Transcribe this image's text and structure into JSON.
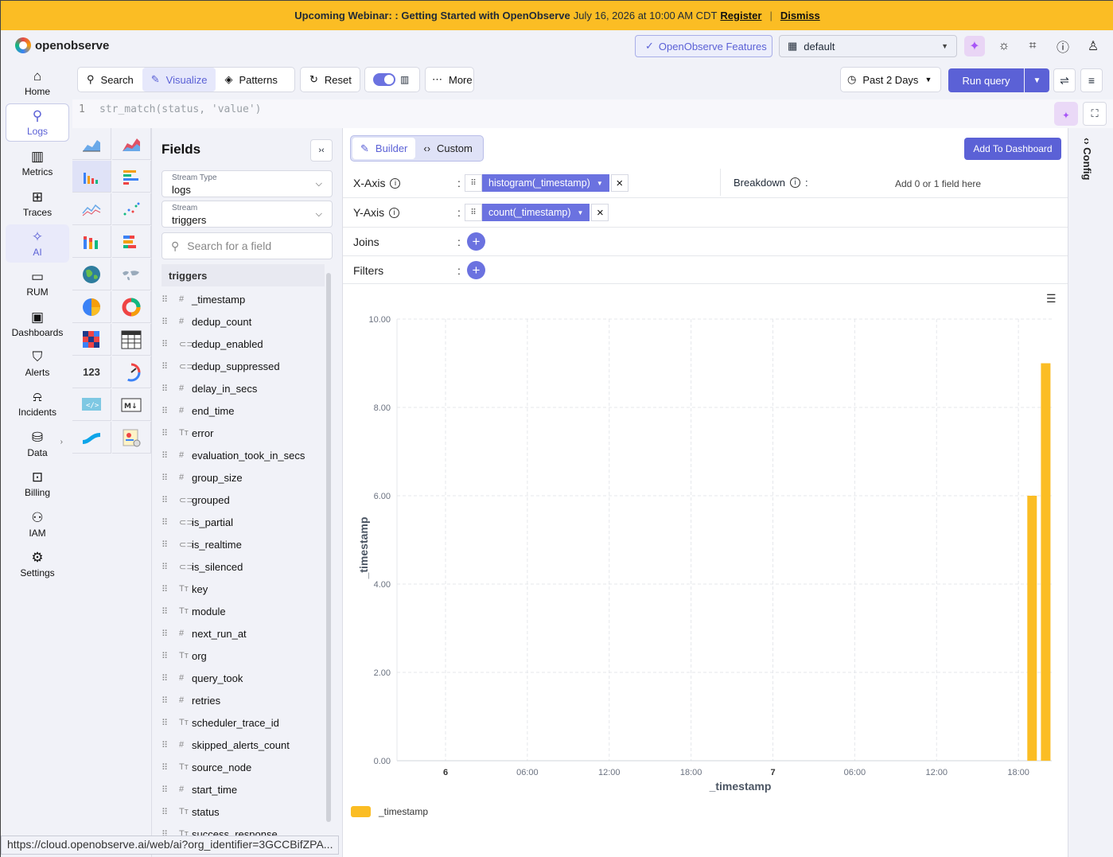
{
  "banner": {
    "title": "Upcoming Webinar: : Getting Started with OpenObserve",
    "date": "July 16, 2026 at 10:00 AM CDT",
    "register": "Register",
    "sep": "|",
    "dismiss": "Dismiss"
  },
  "header": {
    "logo": "openobserve",
    "features_label": "OpenObserve Features",
    "org": "default"
  },
  "sidebar": {
    "items": [
      {
        "label": "Home",
        "icon": "home-icon"
      },
      {
        "label": "Logs",
        "icon": "search-icon"
      },
      {
        "label": "Metrics",
        "icon": "bar-chart-icon"
      },
      {
        "label": "Traces",
        "icon": "traces-icon"
      },
      {
        "label": "AI",
        "icon": "sparkle-icon"
      },
      {
        "label": "RUM",
        "icon": "devices-icon"
      },
      {
        "label": "Dashboards",
        "icon": "dashboard-icon"
      },
      {
        "label": "Alerts",
        "icon": "alert-icon"
      },
      {
        "label": "Incidents",
        "icon": "alarm-icon"
      },
      {
        "label": "Data",
        "icon": "database-icon"
      },
      {
        "label": "Billing",
        "icon": "billing-icon"
      },
      {
        "label": "IAM",
        "icon": "users-icon"
      },
      {
        "label": "Settings",
        "icon": "gear-icon"
      }
    ]
  },
  "toolbar": {
    "search": "Search",
    "visualize": "Visualize",
    "patterns": "Patterns",
    "reset": "Reset",
    "more": "More",
    "time": "Past 2 Days",
    "run": "Run query"
  },
  "editor": {
    "line": "1",
    "code": "str_match(status, 'value')"
  },
  "fields_panel": {
    "title": "Fields",
    "stream_type_label": "Stream Type",
    "stream_type": "logs",
    "stream_label": "Stream",
    "stream": "triggers",
    "search_placeholder": "Search for a field",
    "stream_header": "triggers",
    "items": [
      {
        "name": "_timestamp",
        "type": "#"
      },
      {
        "name": "dedup_count",
        "type": "#"
      },
      {
        "name": "dedup_enabled",
        "type": "⊂⊃"
      },
      {
        "name": "dedup_suppressed",
        "type": "⊂⊃"
      },
      {
        "name": "delay_in_secs",
        "type": "#"
      },
      {
        "name": "end_time",
        "type": "#"
      },
      {
        "name": "error",
        "type": "Tт"
      },
      {
        "name": "evaluation_took_in_secs",
        "type": "#"
      },
      {
        "name": "group_size",
        "type": "#"
      },
      {
        "name": "grouped",
        "type": "⊂⊃"
      },
      {
        "name": "is_partial",
        "type": "⊂⊃"
      },
      {
        "name": "is_realtime",
        "type": "⊂⊃"
      },
      {
        "name": "is_silenced",
        "type": "⊂⊃"
      },
      {
        "name": "key",
        "type": "Tт"
      },
      {
        "name": "module",
        "type": "Tт"
      },
      {
        "name": "next_run_at",
        "type": "#"
      },
      {
        "name": "org",
        "type": "Tт"
      },
      {
        "name": "query_took",
        "type": "#"
      },
      {
        "name": "retries",
        "type": "#"
      },
      {
        "name": "scheduler_trace_id",
        "type": "Tт"
      },
      {
        "name": "skipped_alerts_count",
        "type": "#"
      },
      {
        "name": "source_node",
        "type": "Tт"
      },
      {
        "name": "start_time",
        "type": "#"
      },
      {
        "name": "status",
        "type": "Tт"
      },
      {
        "name": "success_response",
        "type": "Tт"
      }
    ]
  },
  "builder": {
    "builder_tab": "Builder",
    "custom_tab": "Custom",
    "add_to_dashboard": "Add To Dashboard",
    "x_axis_label": "X-Axis",
    "x_field": "histogram(_timestamp)",
    "breakdown_label": "Breakdown",
    "breakdown_hint": "Add 0 or 1 field here",
    "y_axis_label": "Y-Axis",
    "y_field": "count(_timestamp)",
    "joins_label": "Joins",
    "filters_label": "Filters",
    "colon": ":"
  },
  "config_label": "Config",
  "status_url": "https://cloud.openobserve.ai/web/ai?org_identifier=3GCCBifZPA...",
  "chart_data": {
    "type": "bar",
    "x_ticks": [
      "6",
      "06:00",
      "12:00",
      "18:00",
      "7",
      "06:00",
      "12:00",
      "18:00"
    ],
    "x_ticks_bold": [
      true,
      false,
      false,
      false,
      true,
      false,
      false,
      false
    ],
    "y_ticks": [
      "0.00",
      "2.00",
      "4.00",
      "6.00",
      "8.00",
      "10.00"
    ],
    "ylim": [
      0,
      10
    ],
    "xlabel": "_timestamp",
    "ylabel": "_timestamp",
    "bar_color": "#fbbd24",
    "bars": [
      {
        "x": "2026-07-07 19:00",
        "value": 6
      },
      {
        "x": "2026-07-07 20:00",
        "value": 9
      }
    ],
    "legend": [
      {
        "name": "_timestamp",
        "color": "#fbbd24"
      }
    ],
    "grid": true
  }
}
